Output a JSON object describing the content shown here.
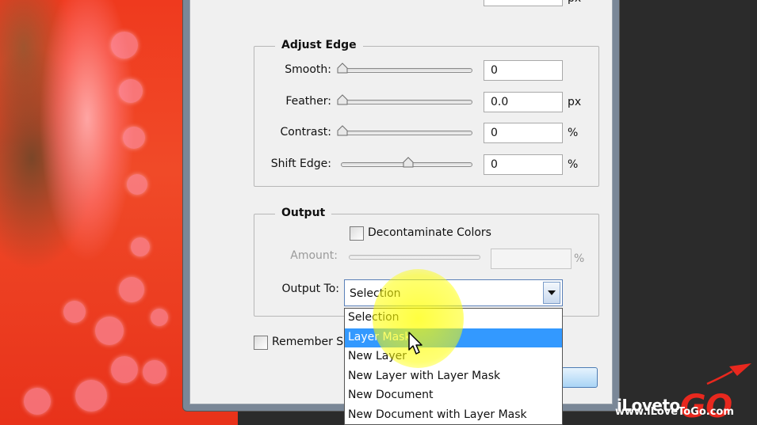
{
  "adjust_edge": {
    "title": "Adjust Edge",
    "smooth": {
      "label": "Smooth:",
      "value": "0",
      "slider_fraction": 0.0
    },
    "feather": {
      "label": "Feather:",
      "value": "0.0",
      "unit": "px",
      "slider_fraction": 0.0
    },
    "contrast": {
      "label": "Contrast:",
      "value": "0",
      "unit": "%",
      "slider_fraction": 0.0
    },
    "shift_edge": {
      "label": "Shift Edge:",
      "value": "0",
      "unit": "%",
      "slider_fraction": 0.5
    }
  },
  "output": {
    "title": "Output",
    "decontaminate_label": "Decontaminate Colors",
    "amount_label": "Amount:",
    "amount_unit": "%",
    "output_to_label": "Output To:",
    "output_to_value": "Selection",
    "options": [
      "Selection",
      "Layer Mask",
      "New Layer",
      "New Layer with Layer Mask",
      "New Document",
      "New Document with Layer Mask"
    ],
    "highlighted_option": "Layer Mask"
  },
  "remember_label": "Remember Se",
  "top_partial_unit": "px",
  "logo": {
    "brand_prefix": "iLoveto",
    "brand_suffix": "GO",
    "url": "www.iLoveToGo.com"
  },
  "colors": {
    "highlight": "#3399ff",
    "spotlight": "#ffff00",
    "logo_red": "#e8281e"
  }
}
